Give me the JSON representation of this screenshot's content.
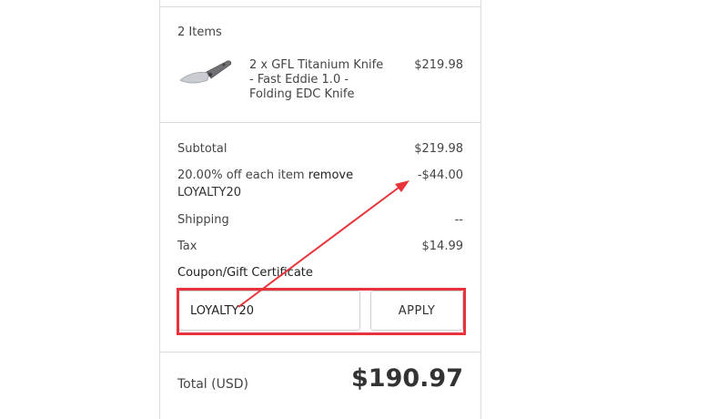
{
  "summary": {
    "items_count": "2 Items",
    "product": {
      "name": "2 x GFL Titanium Knife\n- Fast Eddie 1.0 -\nFolding EDC Knife",
      "price": "$219.98",
      "thumbnail_icon": "folding-knife-icon"
    },
    "subtotal_label": "Subtotal",
    "subtotal_value": "$219.98",
    "discount_label": "20.00% off each item",
    "discount_remove": "remove",
    "discount_code": "LOYALTY20",
    "discount_value": "-$44.00",
    "shipping_label": "Shipping",
    "shipping_value": "--",
    "tax_label": "Tax",
    "tax_value": "$14.99",
    "coupon_label": "Coupon/Gift Certificate",
    "coupon_input_value": "LOYALTY20",
    "apply_label": "APPLY",
    "total_label": "Total (USD)",
    "total_value": "$190.97"
  },
  "colors": {
    "annotation_red": "#e8333a",
    "border": "#dcdcdc",
    "text": "#333333"
  }
}
